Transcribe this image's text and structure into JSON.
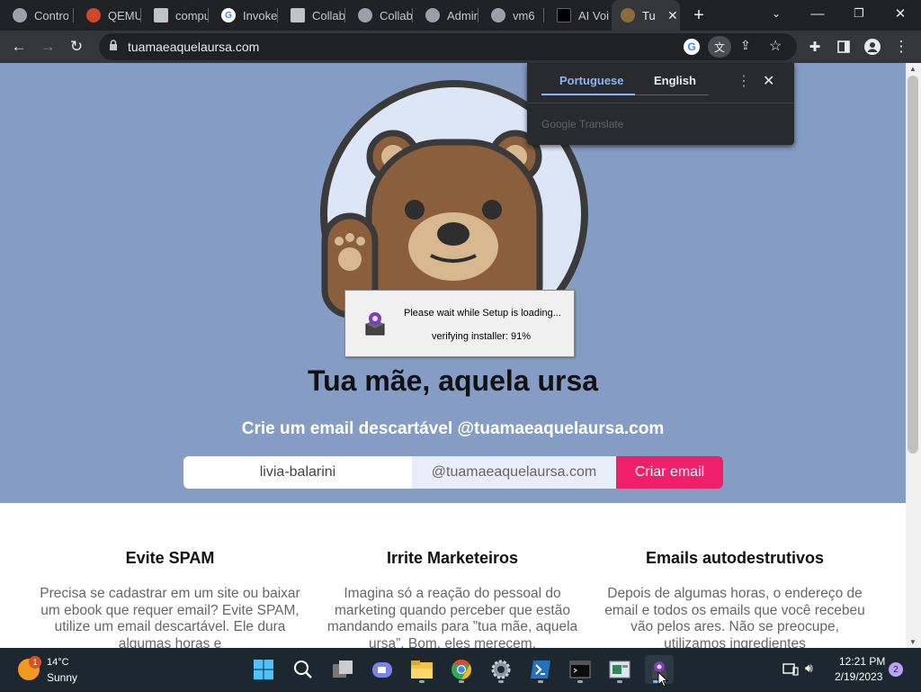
{
  "browser": {
    "tabs": [
      {
        "label": "Contro",
        "icon": "github-icon"
      },
      {
        "label": "QEMU",
        "icon": "qemu-icon"
      },
      {
        "label": "compu",
        "icon": "stack-icon"
      },
      {
        "label": "Invoke",
        "icon": "google-icon"
      },
      {
        "label": "Collab",
        "icon": "stack-icon"
      },
      {
        "label": "Collab",
        "icon": "github-icon"
      },
      {
        "label": "Admin",
        "icon": "github-icon"
      },
      {
        "label": "vm6",
        "icon": "github-icon"
      },
      {
        "label": "AI Voi",
        "icon": "app-icon"
      },
      {
        "label": "Tu",
        "icon": "bear-icon"
      }
    ],
    "url": "tuamaeaquelaursa.com"
  },
  "translate": {
    "source": "Portuguese",
    "target": "English",
    "provider": "Google Translate"
  },
  "page": {
    "title": "Tua mãe, aquela ursa",
    "subtitle": "Crie um email descartável @tuamaeaquelaursa.com",
    "username": "livia-balarini",
    "domain": "@tuamaeaquelaursa.com",
    "button": "Criar email",
    "features": [
      {
        "title": "Evite SPAM",
        "text": "Precisa se cadastrar em um site ou baixar um ebook que requer email? Evite SPAM, utilize um email descartável. Ele dura algumas horas e"
      },
      {
        "title": "Irrite Marketeiros",
        "text": "Imagina só a reação do pessoal do marketing quando perceber que estão mandando emails para ”tua mãe, aquela ursa”. Bom, eles merecem."
      },
      {
        "title": "Emails autodestrutivos",
        "text": "Depois de algumas horas, o endereço de email e todos os emails que você recebeu vão pelos ares. Não se preocupe, utilizamos ingredientes"
      }
    ]
  },
  "setup_dialog": {
    "message": "Please wait while Setup is loading...",
    "progress_text": "verifying installer: 91%",
    "progress": 91
  },
  "taskbar": {
    "weather_temp": "14°C",
    "weather_desc": "Sunny",
    "weather_badge": "1",
    "time": "12:21 PM",
    "date": "2/19/2023",
    "notifications": "2"
  },
  "colors": {
    "hero_bg": "#859cc4",
    "button": "#ef1f6a",
    "bear_brown": "#8b5e3c"
  }
}
